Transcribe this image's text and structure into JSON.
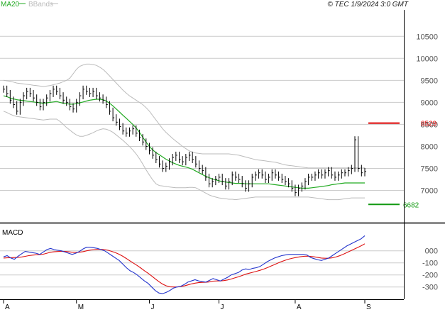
{
  "header": {
    "legend": [
      {
        "label": "MA20",
        "color": "#22aa22"
      },
      {
        "label": "BBands",
        "color": "#bbbbbb"
      }
    ],
    "copyright": "© TEC 1/9/2024 3:0 GMT"
  },
  "colors": {
    "price": "#000000",
    "ma20": "#22aa22",
    "bbands": "#bbbbbb",
    "resistance": "#dd0000",
    "support": "#119911",
    "macd": "#2233cc",
    "signal": "#dd1111",
    "grid": "#cccccc"
  },
  "chart_data": [
    {
      "type": "line",
      "title": "",
      "ylim": [
        6300,
        11100
      ],
      "yticks": [
        "10500",
        "10000",
        "9500",
        "9000",
        "8500",
        "8000",
        "7500",
        "7000"
      ],
      "ytick_values": [
        10500,
        10000,
        9500,
        9000,
        8500,
        8000,
        7500,
        7000
      ],
      "months": [
        "A",
        "M",
        "J",
        "J",
        "A",
        "S"
      ],
      "month_index": [
        0,
        22,
        44,
        65,
        88,
        109
      ],
      "n_bars": 110,
      "series": [
        {
          "name": "MA20",
          "color": "#22aa22",
          "values": [
            9150,
            9130,
            9100,
            9080,
            9060,
            9050,
            9040,
            9030,
            9020,
            9010,
            9000,
            8990,
            8980,
            8990,
            9000,
            9010,
            9020,
            9000,
            8980,
            8970,
            8960,
            8960,
            8970,
            8990,
            9010,
            9030,
            9050,
            9060,
            9070,
            9070,
            9060,
            9030,
            8980,
            8920,
            8850,
            8780,
            8710,
            8640,
            8570,
            8500,
            8420,
            8320,
            8210,
            8100,
            8000,
            7920,
            7860,
            7810,
            7760,
            7710,
            7670,
            7630,
            7600,
            7570,
            7550,
            7530,
            7510,
            7480,
            7440,
            7400,
            7360,
            7320,
            7290,
            7260,
            7240,
            7220,
            7200,
            7190,
            7180,
            7170,
            7160,
            7160,
            7160,
            7150,
            7150,
            7150,
            7150,
            7150,
            7150,
            7150,
            7150,
            7140,
            7130,
            7120,
            7110,
            7100,
            7090,
            7080,
            7070,
            7060,
            7050,
            7050,
            7050,
            7060,
            7070,
            7080,
            7090,
            7100,
            7110,
            7130,
            7140,
            7150,
            7160,
            7170,
            7170,
            7170,
            7170,
            7170,
            7170,
            7170
          ]
        },
        {
          "name": "BBands",
          "color": "#bbbbbb",
          "upper": [
            9500,
            9490,
            9480,
            9460,
            9440,
            9430,
            9420,
            9410,
            9400,
            9390,
            9380,
            9370,
            9360,
            9370,
            9380,
            9400,
            9420,
            9440,
            9470,
            9500,
            9550,
            9650,
            9750,
            9820,
            9850,
            9870,
            9870,
            9860,
            9840,
            9800,
            9750,
            9680,
            9600,
            9520,
            9440,
            9360,
            9280,
            9210,
            9150,
            9100,
            9050,
            9000,
            8950,
            8880,
            8800,
            8700,
            8600,
            8500,
            8400,
            8320,
            8250,
            8180,
            8120,
            8060,
            8000,
            7950,
            7900,
            7870,
            7850,
            7840,
            7830,
            7830,
            7830,
            7830,
            7830,
            7830,
            7830,
            7830,
            7830,
            7820,
            7810,
            7800,
            7780,
            7760,
            7740,
            7720,
            7700,
            7690,
            7680,
            7670,
            7660,
            7650,
            7640,
            7620,
            7600,
            7580,
            7570,
            7560,
            7550,
            7540,
            7530,
            7520,
            7510,
            7510,
            7510,
            7510,
            7510,
            7510,
            7510,
            7510,
            7510,
            7510,
            7510,
            7510,
            7510,
            7510,
            7510,
            7510,
            7510,
            7510
          ],
          "lower": [
            8800,
            8770,
            8730,
            8700,
            8680,
            8670,
            8660,
            8650,
            8640,
            8630,
            8620,
            8610,
            8600,
            8610,
            8620,
            8620,
            8620,
            8570,
            8500,
            8430,
            8370,
            8310,
            8260,
            8230,
            8230,
            8250,
            8280,
            8310,
            8350,
            8380,
            8400,
            8390,
            8360,
            8320,
            8260,
            8200,
            8140,
            8070,
            8000,
            7920,
            7830,
            7720,
            7600,
            7470,
            7350,
            7240,
            7150,
            7110,
            7100,
            7090,
            7080,
            7070,
            7060,
            7060,
            7060,
            7060,
            7070,
            7070,
            7060,
            7020,
            6980,
            6940,
            6900,
            6870,
            6850,
            6830,
            6820,
            6810,
            6800,
            6800,
            6790,
            6800,
            6810,
            6820,
            6830,
            6840,
            6850,
            6850,
            6850,
            6850,
            6850,
            6850,
            6850,
            6850,
            6850,
            6850,
            6850,
            6850,
            6850,
            6850,
            6850,
            6850,
            6850,
            6840,
            6830,
            6820,
            6810,
            6800,
            6790,
            6790,
            6790,
            6790,
            6800,
            6810,
            6820,
            6830,
            6830,
            6830,
            6830,
            6830
          ]
        },
        {
          "name": "Price",
          "color": "#000000",
          "values": [
            9300,
            9200,
            9050,
            8950,
            8800,
            9000,
            9150,
            9250,
            9200,
            9100,
            9000,
            8900,
            9000,
            9100,
            9200,
            9300,
            9250,
            9150,
            9050,
            9000,
            8900,
            8850,
            9000,
            9150,
            9300,
            9250,
            9200,
            9250,
            9150,
            9100,
            9050,
            8950,
            8800,
            8650,
            8550,
            8450,
            8350,
            8300,
            8350,
            8400,
            8300,
            8200,
            8100,
            8000,
            7900,
            7800,
            7700,
            7600,
            7500,
            7550,
            7650,
            7750,
            7800,
            7700,
            7650,
            7750,
            7800,
            7700,
            7600,
            7500,
            7450,
            7300,
            7150,
            7200,
            7250,
            7300,
            7200,
            7100,
            7200,
            7350,
            7300,
            7250,
            7150,
            7050,
            7150,
            7300,
            7350,
            7400,
            7350,
            7250,
            7300,
            7400,
            7350,
            7300,
            7250,
            7200,
            7150,
            7050,
            6950,
            7050,
            7100,
            7200,
            7300,
            7300,
            7350,
            7400,
            7350,
            7400,
            7450,
            7350,
            7300,
            7350,
            7400,
            7400,
            7450,
            7500,
            8150,
            7500,
            7400,
            7430
          ]
        },
        {
          "name": "Resistance",
          "color": "#dd0000",
          "value": 8529
        },
        {
          "name": "Support",
          "color": "#119911",
          "value": 6682
        }
      ],
      "labels": {
        "resistance": "8529",
        "support": "6682"
      }
    },
    {
      "type": "line",
      "title": "MACD",
      "ylim": [
        -390,
        210
      ],
      "yticks": [
        "000",
        "-100",
        "-200",
        "-300"
      ],
      "ytick_values": [
        0,
        -100,
        -200,
        -300
      ],
      "series": [
        {
          "name": "MACD",
          "color": "#2233cc",
          "values": [
            -50,
            -40,
            -60,
            -70,
            -45,
            -25,
            -5,
            -10,
            -15,
            -20,
            -30,
            -10,
            10,
            20,
            10,
            5,
            0,
            -10,
            -20,
            -30,
            -20,
            -5,
            15,
            30,
            30,
            25,
            20,
            10,
            0,
            -20,
            -40,
            -60,
            -80,
            -110,
            -140,
            -165,
            -180,
            -200,
            -225,
            -250,
            -270,
            -300,
            -330,
            -350,
            -355,
            -345,
            -330,
            -310,
            -300,
            -295,
            -280,
            -260,
            -250,
            -240,
            -250,
            -255,
            -260,
            -245,
            -230,
            -240,
            -250,
            -235,
            -220,
            -200,
            -190,
            -180,
            -160,
            -150,
            -155,
            -145,
            -140,
            -130,
            -110,
            -90,
            -75,
            -60,
            -50,
            -40,
            -35,
            -30,
            -30,
            -30,
            -30,
            -30,
            -35,
            -55,
            -65,
            -75,
            -80,
            -70,
            -60,
            -40,
            -20,
            0,
            20,
            40,
            55,
            70,
            85,
            100,
            125
          ]
        },
        {
          "name": "Signal",
          "color": "#dd1111",
          "values": [
            -60,
            -58,
            -57,
            -56,
            -54,
            -51,
            -46,
            -40,
            -36,
            -33,
            -32,
            -28,
            -20,
            -12,
            -8,
            -6,
            -4,
            -5,
            -8,
            -12,
            -14,
            -12,
            -7,
            0,
            6,
            10,
            12,
            12,
            10,
            4,
            -5,
            -16,
            -29,
            -45,
            -64,
            -84,
            -103,
            -122,
            -143,
            -165,
            -186,
            -209,
            -233,
            -256,
            -276,
            -290,
            -298,
            -300,
            -300,
            -297,
            -291,
            -283,
            -275,
            -268,
            -264,
            -262,
            -261,
            -258,
            -252,
            -250,
            -250,
            -247,
            -242,
            -234,
            -225,
            -216,
            -205,
            -194,
            -186,
            -178,
            -170,
            -162,
            -152,
            -140,
            -127,
            -114,
            -101,
            -89,
            -78,
            -69,
            -61,
            -55,
            -50,
            -46,
            -44,
            -46,
            -50,
            -55,
            -60,
            -62,
            -62,
            -58,
            -51,
            -41,
            -29,
            -15,
            -1,
            13,
            27,
            42,
            58
          ]
        }
      ]
    }
  ]
}
